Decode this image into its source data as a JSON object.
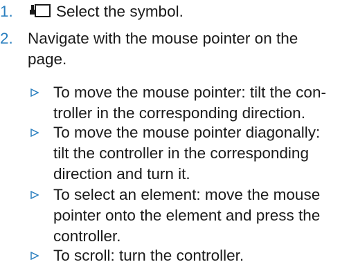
{
  "steps": [
    {
      "number": "1.",
      "icon": "controller-display-icon",
      "text": "Select the symbol."
    },
    {
      "number": "2.",
      "text": "Navigate with the mouse pointer on the page."
    }
  ],
  "bullets": [
    {
      "line1": "To move the mouse pointer: tilt the con-",
      "line2": "troller in the corresponding direction."
    },
    {
      "line1": "To move the mouse pointer diagonally:",
      "line2": "tilt the controller in the corresponding",
      "line3": "direction and turn it."
    },
    {
      "line1": "To select an element: move the mouse",
      "line2": "pointer onto the element and press the",
      "line3": "controller."
    },
    {
      "line1": "To scroll: turn the controller."
    }
  ],
  "colors": {
    "step_number": "#2a7fbf",
    "text": "#1a1a1a",
    "bullet_marker": "#2a7fbf"
  }
}
